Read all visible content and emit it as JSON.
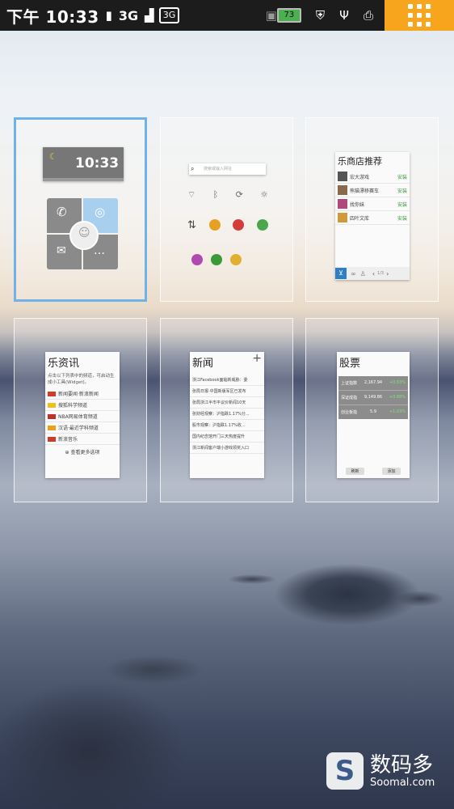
{
  "status_bar": {
    "time": "下午 10:33",
    "network": "3G",
    "network_box": "3G",
    "battery_level": "73"
  },
  "screens": {
    "s1": {
      "clock_time": "10:33"
    },
    "s2": {
      "search_placeholder": "搜索或输入网址"
    },
    "s3": {
      "title": "乐商店推荐",
      "page": "1/3",
      "apps": [
        {
          "name": "宏大游戏",
          "action": "安装"
        },
        {
          "name": "熊猫漂移赛车",
          "action": "安装"
        },
        {
          "name": "找你妹",
          "action": "安装"
        },
        {
          "name": "四叶文库",
          "action": "安装"
        }
      ]
    },
    "s4": {
      "title": "乐资讯",
      "intro": "点击以下列表中的频道，可启动生成小工具(Widget)。",
      "channels": [
        "新闻要闻·新浪新闻",
        "搜狐科学频道",
        "NBA网易体育频道",
        "汉语·最近学科频道",
        "新浪音乐"
      ],
      "more": "查看更多选项"
    },
    "s5": {
      "title": "新闻",
      "items": [
        "浙江Facebook面临新威胁：委",
        "张局日报·中国新版军区已发布",
        "张局浙江半市平议价新闻10天",
        "张财经观察：沪指跌1.17%分...",
        "股市观察：沪指跌1.17%收...",
        "国内纪念馆开门三天热度提升",
        "浙江新闻客户端小游戏领奖入口"
      ]
    },
    "s6": {
      "title": "股票",
      "rows": [
        {
          "name": "上证指数",
          "price": "2,167.94",
          "change": "+0.63%"
        },
        {
          "name": "深证成指",
          "price": "9,149.86",
          "change": "+0.88%"
        },
        {
          "name": "创业板指",
          "price": "5.9",
          "change": "+1.03%"
        }
      ],
      "buttons": [
        "刷新",
        "添加"
      ]
    }
  },
  "watermark": {
    "logo_letter": "S",
    "name": "数码多",
    "site": "Soomal.com"
  },
  "colors": {
    "menu_button": "#f7a51d",
    "selected_border": "#6fb2e8",
    "status_bar": "#1c1c1c"
  }
}
